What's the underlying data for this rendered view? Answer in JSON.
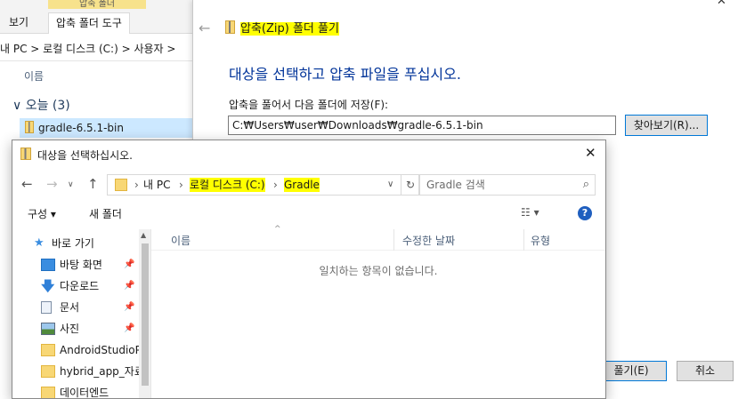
{
  "bg_explorer": {
    "context_tab_header": "압축 폴더",
    "tabs": [
      "보기",
      "압축 폴더 도구"
    ],
    "address": "내 PC  >  로컬 디스크 (C:)  >  사용자  >",
    "column_name": "이름",
    "group_label": "오늘 (3)",
    "selected_file": "gradle-6.5.1-bin"
  },
  "wizard": {
    "title": "압축(Zip) 폴더 풀기",
    "heading": "대상을 선택하고 압축 파일을 푸십시오.",
    "dest_label": "압축을 풀어서 다음 폴더에 저장(F):",
    "dest_path": "C:₩Users₩user₩Downloads₩gradle-6.5.1-bin",
    "browse_button": "찾아보기(R)...",
    "extract_button": "풀기(E)",
    "cancel_button": "취소"
  },
  "picker": {
    "title": "대상을 선택하십시오.",
    "breadcrumb": [
      "내 PC",
      "로컬 디스크 (C:)",
      "Gradle"
    ],
    "search_placeholder": "Gradle 검색",
    "toolbar": {
      "organize": "구성 ▾",
      "new_folder": "새 폴더"
    },
    "nav_items": [
      {
        "label": "바로 가기",
        "icon": "star-icon"
      },
      {
        "label": "바탕 화면",
        "icon": "desktop-icon",
        "pinned": true
      },
      {
        "label": "다운로드",
        "icon": "download-icon",
        "pinned": true
      },
      {
        "label": "문서",
        "icon": "document-icon",
        "pinned": true
      },
      {
        "label": "사진",
        "icon": "picture-icon",
        "pinned": true
      },
      {
        "label": "AndroidStudioP",
        "icon": "folder-icon"
      },
      {
        "label": "hybrid_app_자료",
        "icon": "folder-icon"
      },
      {
        "label": "데이터엔드",
        "icon": "folder-icon"
      }
    ],
    "columns": [
      "이름",
      "수정한 날짜",
      "유형"
    ],
    "empty_message": "일치하는 항목이 없습니다."
  },
  "colors": {
    "highlight": "#ffff00",
    "heading_blue": "#003399",
    "selection": "#cce8ff",
    "accent": "#0078d7"
  }
}
